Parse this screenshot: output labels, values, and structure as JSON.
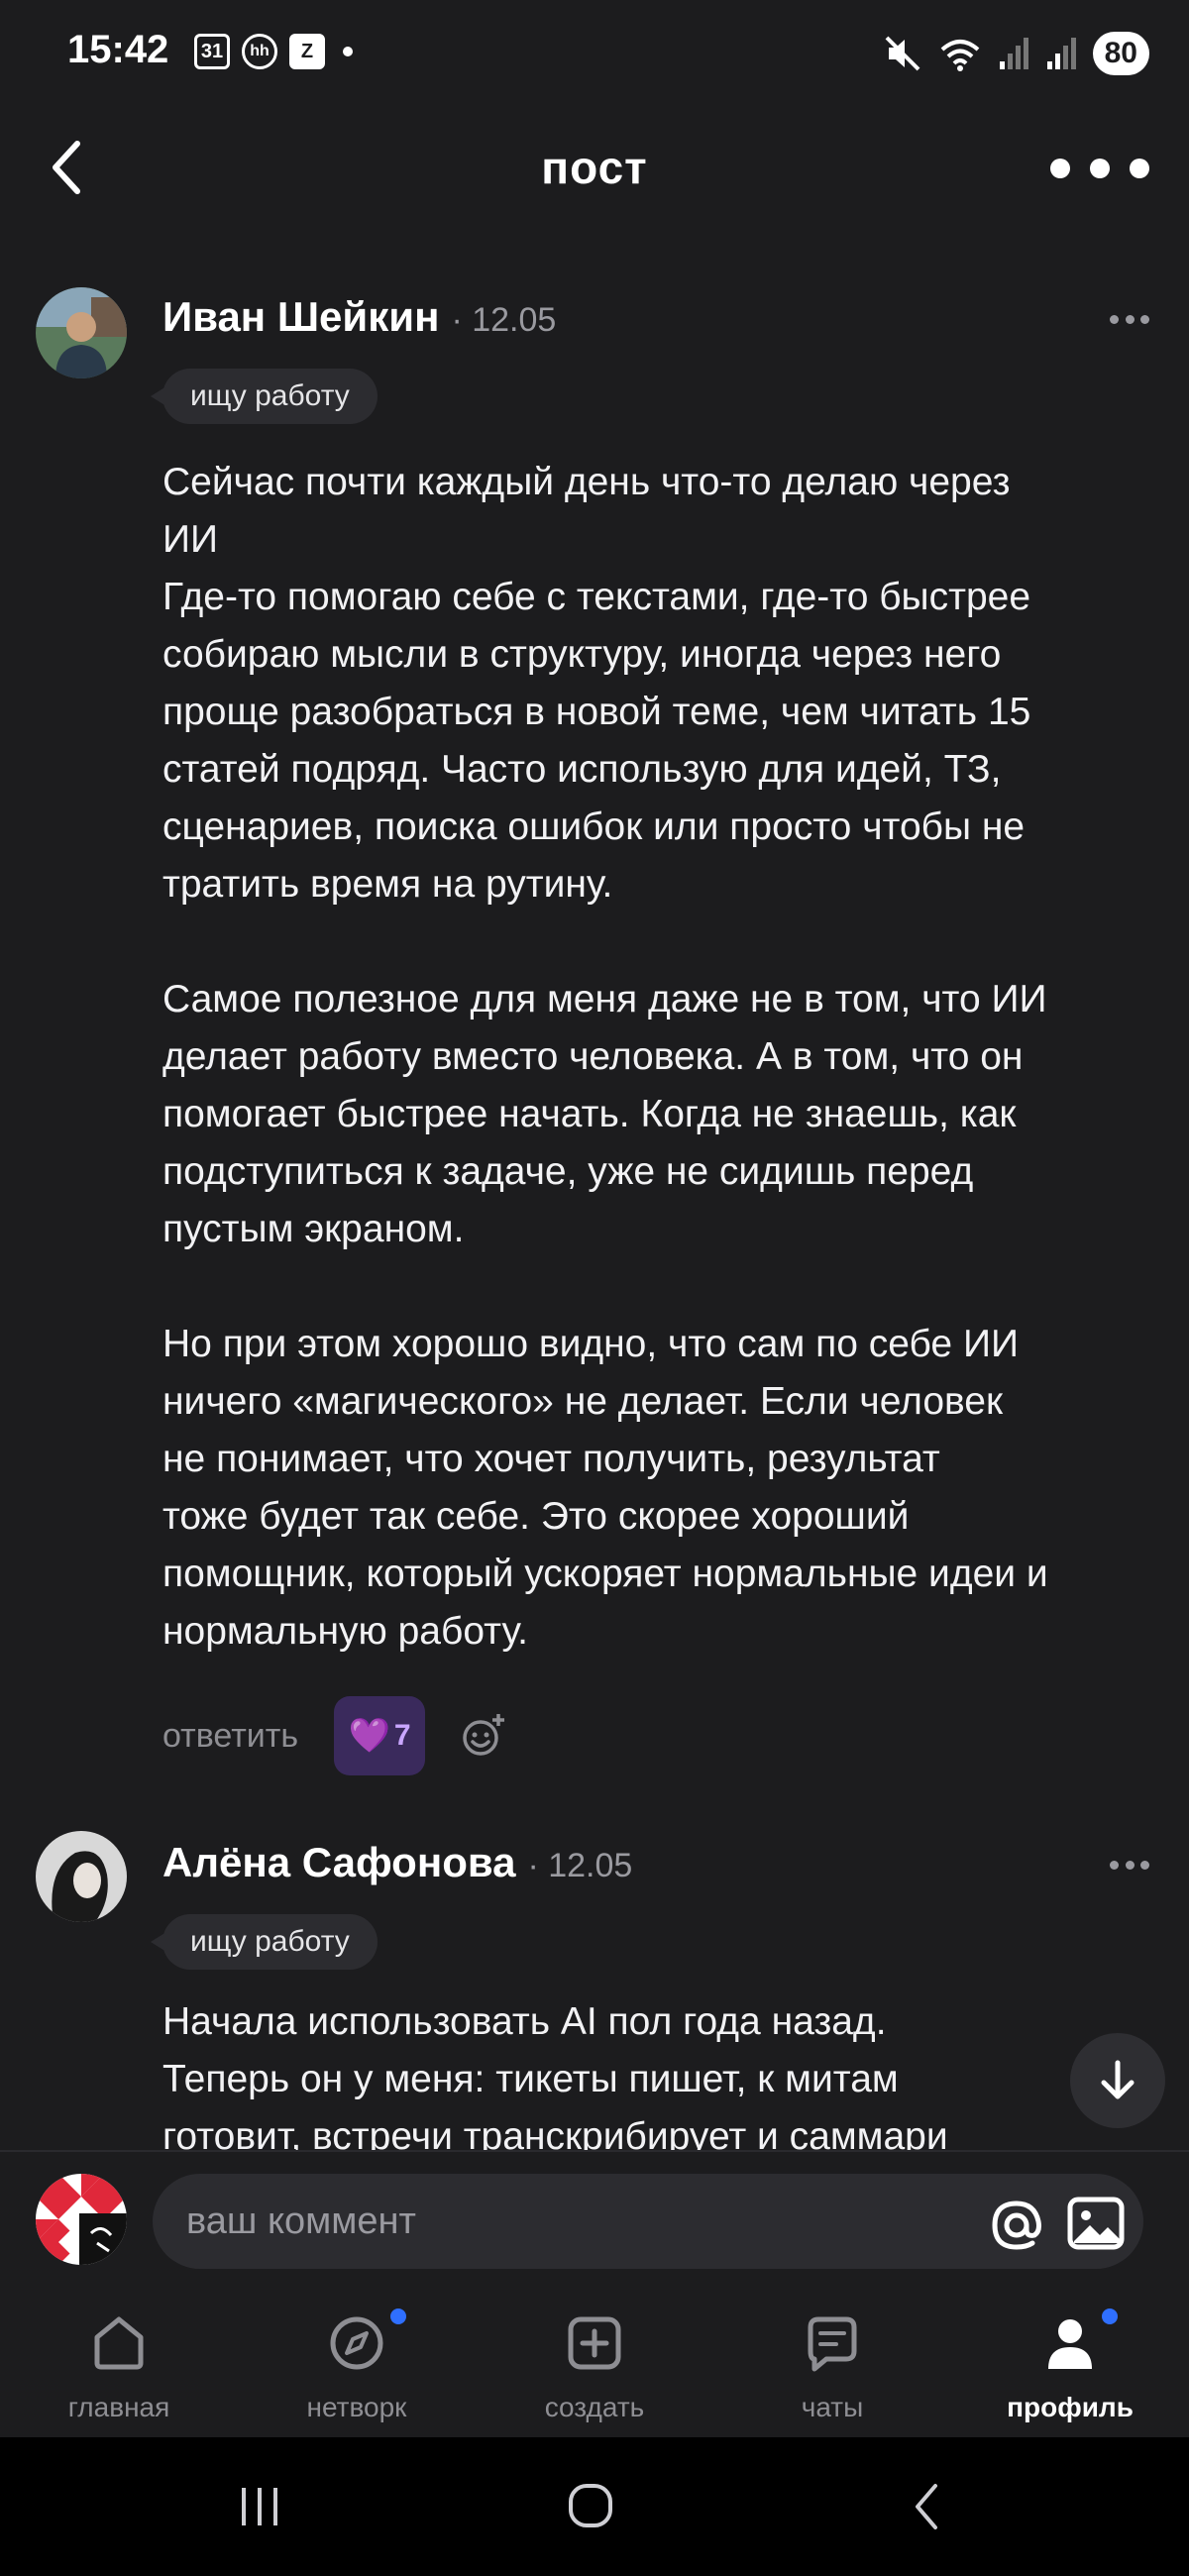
{
  "status_bar": {
    "time": "15:42",
    "calendar_badge": "31",
    "hh_badge": "hh",
    "z_badge": "Z",
    "battery": "80"
  },
  "header": {
    "title": "пост"
  },
  "comments": [
    {
      "author": "Иван Шейкин",
      "date": "· 12.05",
      "tag": "ищу работу",
      "paragraphs": [
        [
          "Сейчас почти каждый день что-то делаю через",
          "ИИ",
          "Где-то помогаю себе с текстами, где-то быстрее",
          "собираю мысли в структуру, иногда через него",
          "проще разобраться в новой теме, чем читать 15",
          "статей подряд. Часто использую для идей, ТЗ,",
          "сценариев, поиска ошибок или просто чтобы не",
          "тратить время на рутину."
        ],
        [
          "Самое полезное для меня даже не в том, что ИИ",
          "делает работу вместо человека. А в том, что он",
          "помогает быстрее начать. Когда не знаешь, как",
          "подступиться к задаче, уже не сидишь перед",
          "пустым экраном."
        ],
        [
          "Но при этом хорошо видно, что сам по себе ИИ",
          "ничего «магического» не делает. Если человек",
          "не понимает, что хочет получить, результат",
          "тоже будет так себе. Это скорее хороший",
          "помощник, который ускоряет нормальные идеи и",
          "нормальную работу."
        ]
      ],
      "reply_label": "ответить",
      "reaction_emoji": "💜",
      "reaction_count": "7"
    },
    {
      "author": "Алёна Сафонова",
      "date": "· 12.05",
      "tag": "ищу работу",
      "lines": [
        "Начала использовать AI пол года назад.",
        "Теперь он у меня: тикеты пишет, к митам",
        "готовит, встречи транскрибирует и саммари"
      ]
    }
  ],
  "composer": {
    "placeholder": "ваш коммент"
  },
  "nav": {
    "items": [
      {
        "label": "главная",
        "icon": "home-icon"
      },
      {
        "label": "нетворк",
        "icon": "compass-icon"
      },
      {
        "label": "создать",
        "icon": "plus-square-icon"
      },
      {
        "label": "чаты",
        "icon": "chat-icon"
      },
      {
        "label": "профиль",
        "icon": "person-icon"
      }
    ],
    "active": "профиль"
  },
  "colors": {
    "background": "#1c1c1e",
    "reaction_bg": "#3a2a5c",
    "notification_dot": "#2f6fff"
  }
}
